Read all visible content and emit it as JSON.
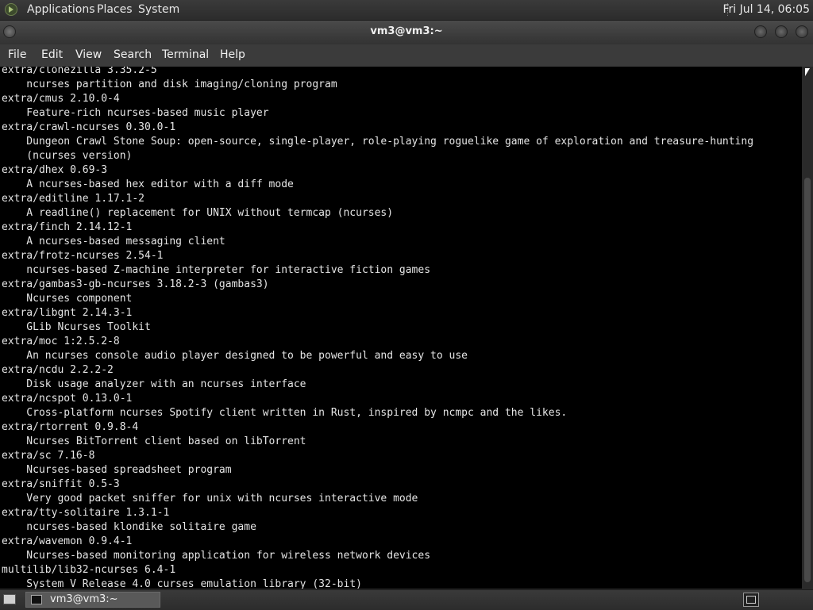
{
  "top_panel": {
    "menus": [
      "Applications",
      "Places",
      "System"
    ],
    "clock": "Fri Jul 14, 06:05"
  },
  "window": {
    "title": "vm3@vm3:~",
    "menu": [
      "File",
      "Edit",
      "View",
      "Search",
      "Terminal",
      "Help"
    ]
  },
  "terminal": {
    "lines": [
      "extra/clonezilla 3.35.2-5",
      "    ncurses partition and disk imaging/cloning program",
      "extra/cmus 2.10.0-4",
      "    Feature-rich ncurses-based music player",
      "extra/crawl-ncurses 0.30.0-1",
      "    Dungeon Crawl Stone Soup: open-source, single-player, role-playing roguelike game of exploration and treasure-hunting",
      "    (ncurses version)",
      "extra/dhex 0.69-3",
      "    A ncurses-based hex editor with a diff mode",
      "extra/editline 1.17.1-2",
      "    A readline() replacement for UNIX without termcap (ncurses)",
      "extra/finch 2.14.12-1",
      "    A ncurses-based messaging client",
      "extra/frotz-ncurses 2.54-1",
      "    ncurses-based Z-machine interpreter for interactive fiction games",
      "extra/gambas3-gb-ncurses 3.18.2-3 (gambas3)",
      "    Ncurses component",
      "extra/libgnt 2.14.3-1",
      "    GLib Ncurses Toolkit",
      "extra/moc 1:2.5.2-8",
      "    An ncurses console audio player designed to be powerful and easy to use",
      "extra/ncdu 2.2.2-2",
      "    Disk usage analyzer with an ncurses interface",
      "extra/ncspot 0.13.0-1",
      "    Cross-platform ncurses Spotify client written in Rust, inspired by ncmpc and the likes.",
      "extra/rtorrent 0.9.8-4",
      "    Ncurses BitTorrent client based on libTorrent",
      "extra/sc 7.16-8",
      "    Ncurses-based spreadsheet program",
      "extra/sniffit 0.5-3",
      "    Very good packet sniffer for unix with ncurses interactive mode",
      "extra/tty-solitaire 1.3.1-1",
      "    ncurses-based klondike solitaire game",
      "extra/wavemon 0.9.4-1",
      "    Ncurses-based monitoring application for wireless network devices",
      "multilib/lib32-ncurses 6.4-1",
      "    System V Release 4.0 curses emulation library (32-bit)"
    ]
  },
  "taskbar": {
    "task_label": "vm3@vm3:~"
  },
  "icons": {
    "distro_logo": "distro-logo-icon",
    "window_menu": "window-menu-icon",
    "show_desktop": "show-desktop-icon",
    "terminal_task": "terminal-icon",
    "tray": "workspace-switcher-icon"
  }
}
